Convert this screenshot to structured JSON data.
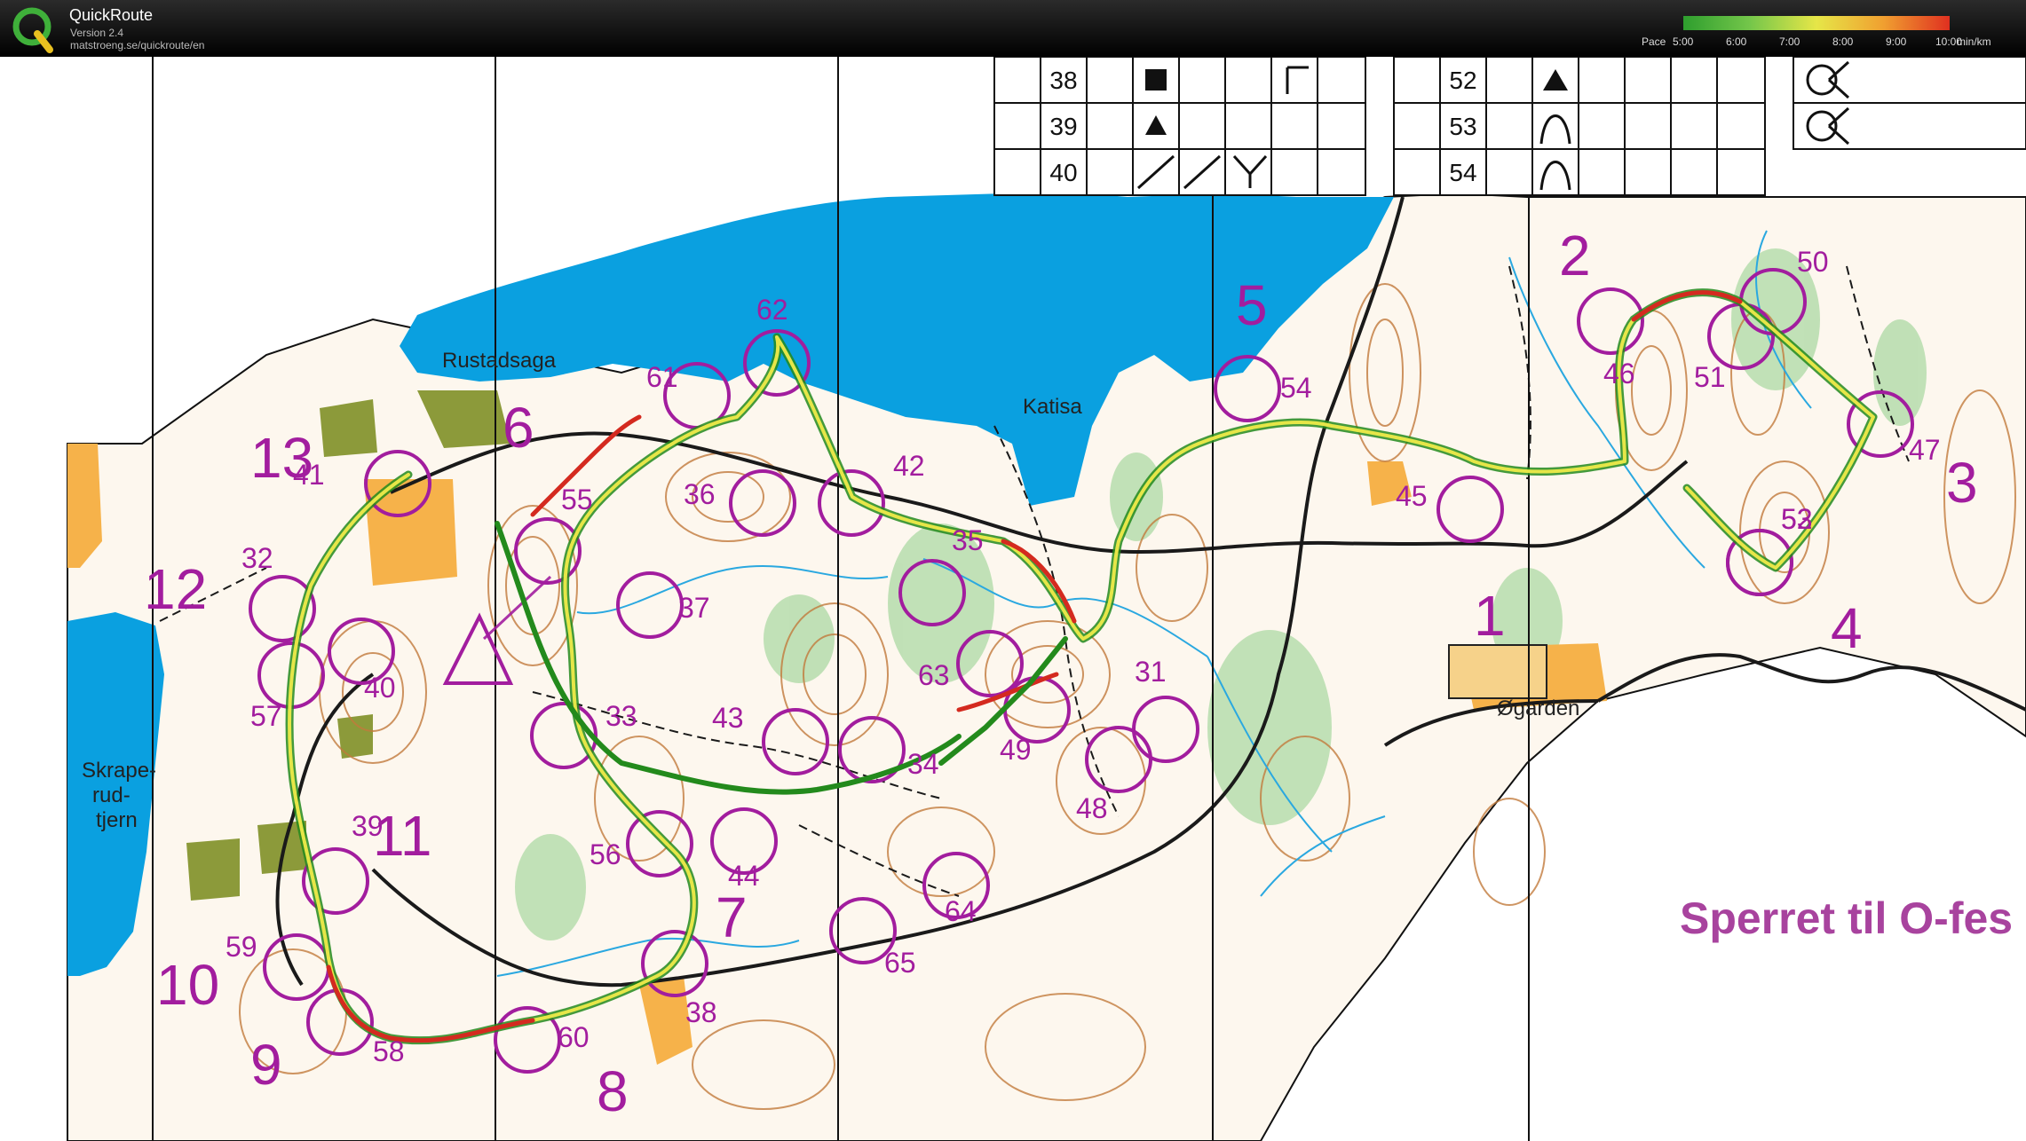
{
  "app": {
    "title": "QuickRoute",
    "version": "Version 2.4",
    "url": "matstroeng.se/quickroute/en"
  },
  "pace_legend": {
    "label": "Pace",
    "ticks": [
      "5:00",
      "6:00",
      "7:00",
      "8:00",
      "9:00",
      "10:00"
    ],
    "unit": "min/km",
    "colors": [
      "#2e9e2e",
      "#74c64a",
      "#e6e648",
      "#f0a030",
      "#e03020"
    ]
  },
  "control_description": {
    "left_rows": [
      "38",
      "39",
      "40"
    ],
    "right_rows": [
      "52",
      "53",
      "54"
    ]
  },
  "map_labels": {
    "rustadsaga": "Rustadsaga",
    "katisa": "Katisa",
    "skrape_1": "Skrape-",
    "skrape_2": "rud-",
    "skrape_3": "tjern",
    "ogarden": "Øgarden",
    "restricted": "Sperret til O-fes"
  },
  "course_numbers": [
    "1",
    "2",
    "3",
    "4",
    "5",
    "6",
    "7",
    "8",
    "9",
    "10",
    "11",
    "12",
    "13"
  ],
  "control_codes": [
    "31",
    "32",
    "33",
    "34",
    "35",
    "36",
    "37",
    "38",
    "39",
    "40",
    "41",
    "42",
    "43",
    "44",
    "45",
    "46",
    "47",
    "48",
    "49",
    "50",
    "51",
    "52",
    "53",
    "54",
    "55",
    "56",
    "57",
    "58",
    "59",
    "60",
    "61",
    "62",
    "63",
    "64",
    "65"
  ],
  "colors": {
    "water": "#0aa0e0",
    "course": "#a21d9e",
    "terrain": "#fdf7ee",
    "contour": "#c27a3c",
    "track_slow": "#d42a1f",
    "track_fast": "#238a1c"
  }
}
